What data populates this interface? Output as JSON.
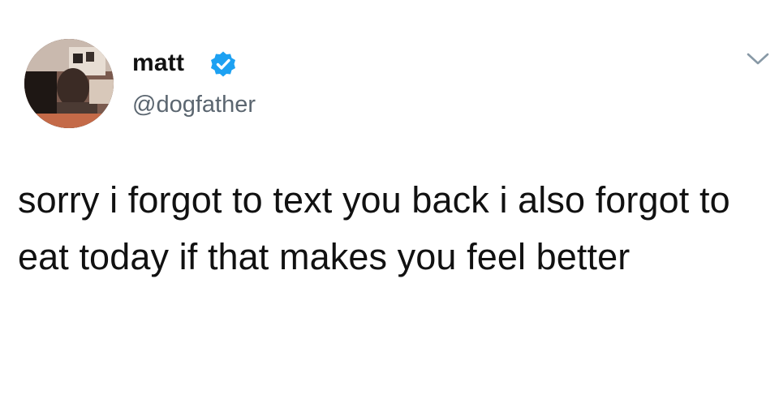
{
  "tweet": {
    "author": {
      "display_name": "matt",
      "handle": "@dogfather",
      "verified": true
    },
    "text": "sorry i forgot to text you back i also forgot to eat today if that makes you feel better",
    "colors": {
      "verified_badge": "#1da1f2",
      "handle": "#5b6670",
      "text": "#111111"
    },
    "icons": {
      "verified": "verified-badge-icon",
      "menu": "chevron-down-icon"
    }
  }
}
